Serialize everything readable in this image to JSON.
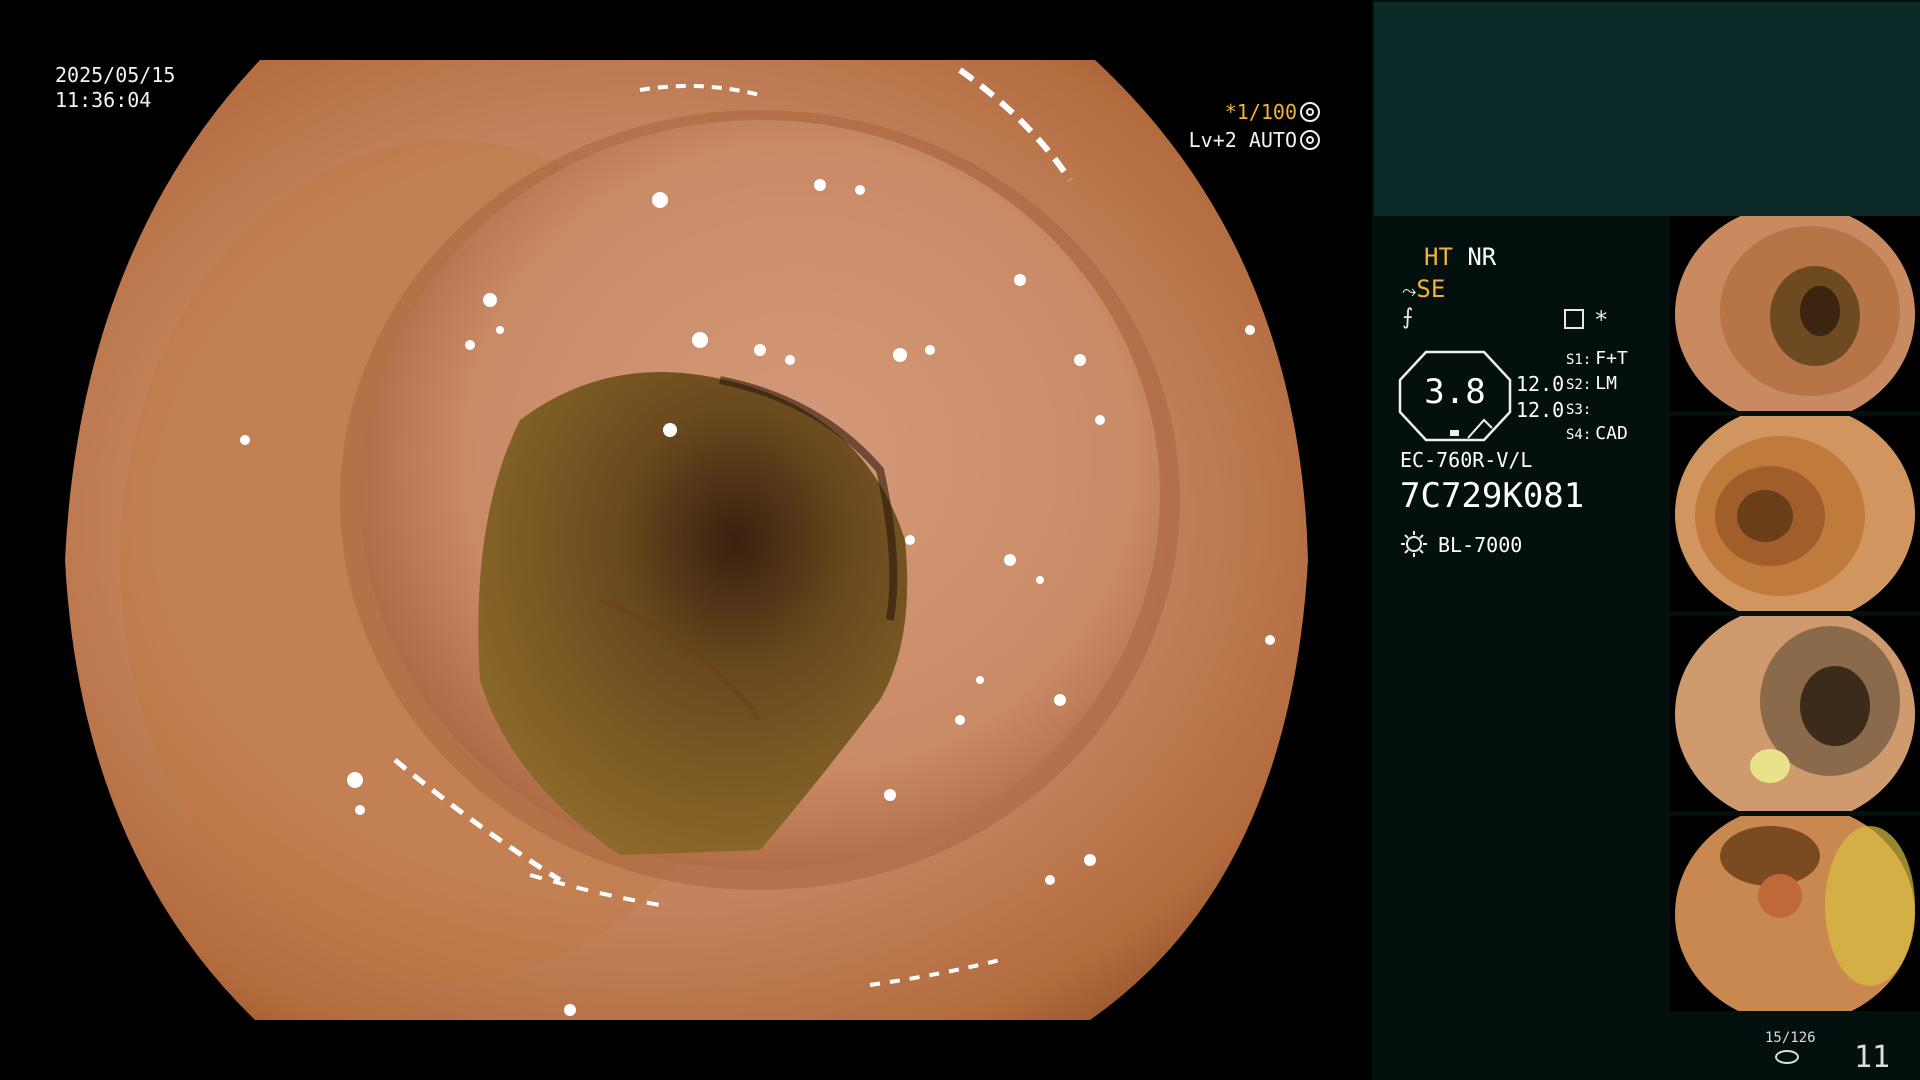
{
  "osd": {
    "date": "2025/05/15",
    "time": "11:36:04",
    "magnification": "*1/100",
    "level": "Lv+2 AUTO"
  },
  "panel": {
    "ht": "HT",
    "nr": "NR",
    "se": "SE",
    "star": "*",
    "zoom_value": "3.8",
    "value_a": "12.0",
    "value_b": "12.0",
    "switches": [
      {
        "key": "S1:",
        "value": "F+T"
      },
      {
        "key": "S2:",
        "value": "LM"
      },
      {
        "key": "S3:",
        "value": ""
      },
      {
        "key": "S4:",
        "value": "CAD"
      }
    ],
    "scope_model": "EC-760R-V/L",
    "scope_serial": "7C729K081",
    "light_source": "BL-7000",
    "image_count": "15/126",
    "page_number": "11"
  },
  "colors": {
    "accent": "#f2b233",
    "panel_bg": "#04100e",
    "panel_top_bg": "#0c2a27",
    "tissue": "#c9825a"
  },
  "icons": [
    "camera-icon",
    "settings-icon",
    "bulb-icon",
    "disk-icon"
  ]
}
